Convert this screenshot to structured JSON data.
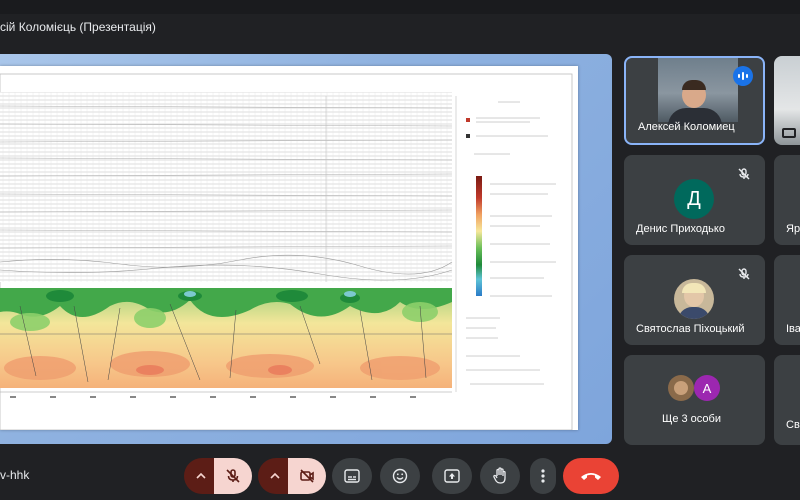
{
  "meeting": {
    "presenter_label": "сій Коломієць (Презентація)",
    "meeting_code": "v-hhk"
  },
  "participants": [
    {
      "name": "Алексей Коломиец",
      "speaking": true,
      "video": true
    },
    {
      "name": "Денис Приходько",
      "initial": "Д",
      "avatar_color": "#00695c",
      "muted": true
    },
    {
      "name": "Святослав Піхоцький",
      "muted": true,
      "photo": true
    },
    {
      "name": "Ще 3 особи",
      "extra_initial": "A",
      "extra_color": "#9c27b0"
    }
  ],
  "right_column": {
    "name_1": "Яр",
    "name_2": "Іва",
    "name_3": "Св"
  },
  "controls": {
    "mic": "mic-off",
    "camera": "camera-off",
    "captions": "captions",
    "emoji": "emoji",
    "present": "present",
    "hand": "raise-hand",
    "more": "more",
    "end_call": "end-call"
  },
  "colors": {
    "background": "#202124",
    "tile": "#3c4043",
    "end_call": "#ea4335",
    "speaking": "#1a73e8",
    "muted_control": "#f6d5d0"
  }
}
